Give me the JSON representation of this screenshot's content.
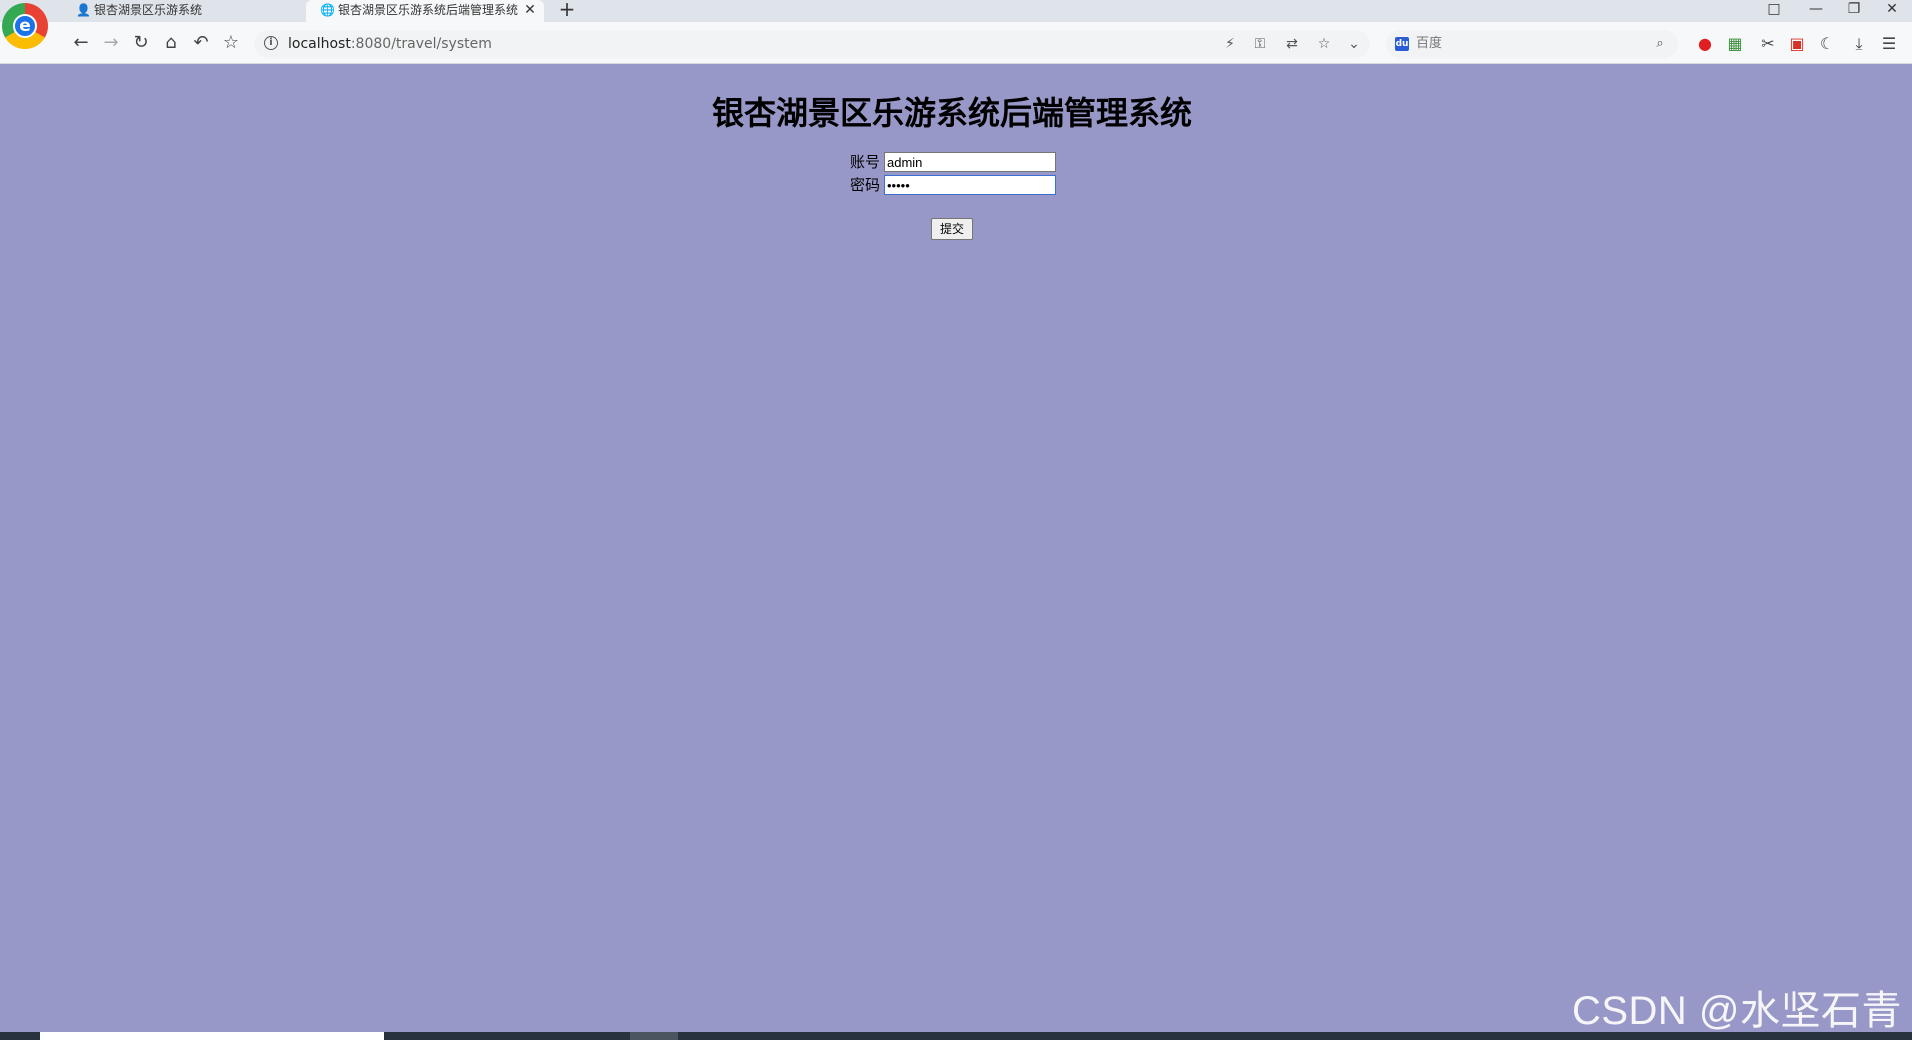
{
  "browser": {
    "tabs": [
      {
        "label": "银杏湖景区乐游系统",
        "icon": "user-icon",
        "active": false
      },
      {
        "label": "银杏湖景区乐游系统后端管理系统",
        "icon": "globe-icon",
        "active": true
      }
    ],
    "new_tab_label": "+",
    "window_controls": [
      "□",
      "—",
      "❐",
      "✕"
    ],
    "address": {
      "host": "localhost",
      "path": ":8080/travel/system"
    },
    "search": {
      "placeholder": "百度"
    }
  },
  "page": {
    "title": "银杏湖景区乐游系统后端管理系统",
    "form": {
      "account_label": "账号",
      "account_value": "admin",
      "password_label": "密码",
      "password_value": "•••••",
      "submit_label": "提交"
    },
    "background_color": "#9898c8"
  },
  "watermark": "CSDN @水坚石青"
}
